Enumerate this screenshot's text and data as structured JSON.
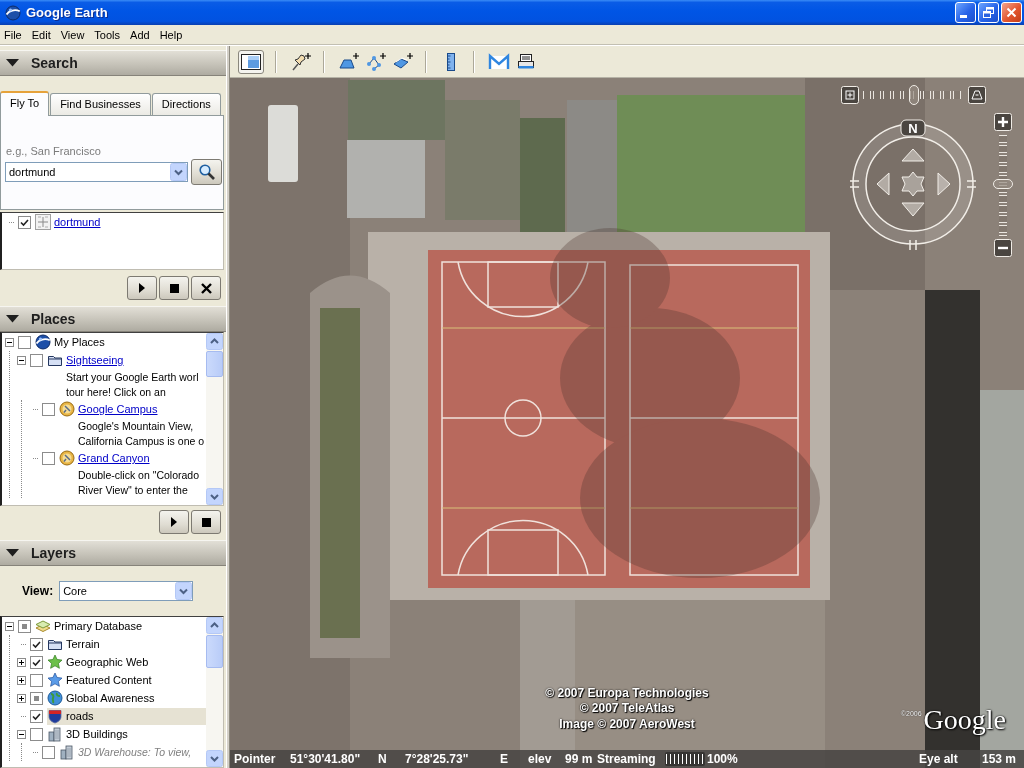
{
  "window": {
    "title": "Google Earth"
  },
  "menu": [
    "File",
    "Edit",
    "View",
    "Tools",
    "Add",
    "Help"
  ],
  "search": {
    "title": "Search",
    "expanded": true,
    "tabs": [
      {
        "label": "Fly To",
        "selected": true
      },
      {
        "label": "Find Businesses",
        "selected": false
      },
      {
        "label": "Directions",
        "selected": false
      }
    ],
    "hint": "e.g., San Francisco",
    "query": "dortmund",
    "results": [
      {
        "kind": "result",
        "label": "dortmund",
        "checked": true,
        "selected": false
      }
    ]
  },
  "places": {
    "title": "Places",
    "expanded": true,
    "items": [
      {
        "kind": "collection",
        "label": "My Places",
        "checked": false,
        "expanded": true,
        "selected": false,
        "children": [
          {
            "kind": "folder",
            "label": "Sightseeing",
            "checked": false,
            "expanded": true,
            "selected": false,
            "description": [
              "Start your Google Earth worl",
              "tour here! Click on an"
            ],
            "children": [
              {
                "kind": "placemark",
                "label": "Google Campus",
                "checked": false,
                "selected": false,
                "description": [
                  "Google's Mountain View,",
                  "California Campus is one o"
                ]
              },
              {
                "kind": "placemark",
                "label": "Grand Canyon",
                "checked": false,
                "selected": false,
                "description": [
                  "Double-click on \"Colorado",
                  "River View\" to enter the"
                ]
              }
            ]
          }
        ]
      }
    ]
  },
  "layers": {
    "title": "Layers",
    "expanded": true,
    "view_label": "View:",
    "view": "Core",
    "items": [
      {
        "kind": "database",
        "label": "Primary Database",
        "checked": false,
        "partial": true,
        "expanded": true,
        "selected": false,
        "disabled": false,
        "children": [
          {
            "kind": "folder",
            "label": "Terrain",
            "checked": true,
            "partial": false,
            "selected": false,
            "disabled": false
          },
          {
            "kind": "web",
            "label": "Geographic Web",
            "checked": true,
            "partial": false,
            "expanded": false,
            "selected": false,
            "disabled": false
          },
          {
            "kind": "featured",
            "label": "Featured Content",
            "checked": false,
            "partial": false,
            "expanded": false,
            "selected": false,
            "disabled": false
          },
          {
            "kind": "awareness",
            "label": "Global Awareness",
            "checked": false,
            "partial": true,
            "expanded": false,
            "selected": false,
            "disabled": false
          },
          {
            "kind": "roads",
            "label": "roads",
            "checked": true,
            "partial": false,
            "selected": true,
            "disabled": false
          },
          {
            "kind": "buildings",
            "label": "3D Buildings",
            "checked": false,
            "partial": false,
            "expanded": true,
            "selected": false,
            "disabled": false,
            "children": [
              {
                "kind": "buildings",
                "label": "3D Warehouse: To view,",
                "checked": false,
                "partial": false,
                "selected": false,
                "disabled": true
              }
            ]
          }
        ]
      }
    ]
  },
  "toolbar": {
    "sidebar_toggle": {
      "selected": true
    }
  },
  "navigation": {
    "north": "N",
    "tilt_slider": {
      "level": 0.51
    },
    "zoom_slider": {
      "level": 0.52
    }
  },
  "map": {
    "attribution": [
      "© 2007 Europa Technologies",
      "© 2007 TeleAtlas",
      "Image © 2007 AeroWest"
    ],
    "logo_note": "©2006",
    "logo": "Google"
  },
  "status_bar": {
    "pointer_label": "Pointer",
    "latitude": "51°30'41.80\"",
    "latitude_hemisphere": "N",
    "longitude": "7°28'25.73\"",
    "longitude_hemisphere": "E",
    "elevation_label": "elev",
    "elevation": "99 m",
    "streaming_label": "Streaming",
    "streaming": {
      "level": 1
    },
    "streaming_percent": "100%",
    "eye_alt_label": "Eye alt",
    "eye_alt": "153 m"
  }
}
